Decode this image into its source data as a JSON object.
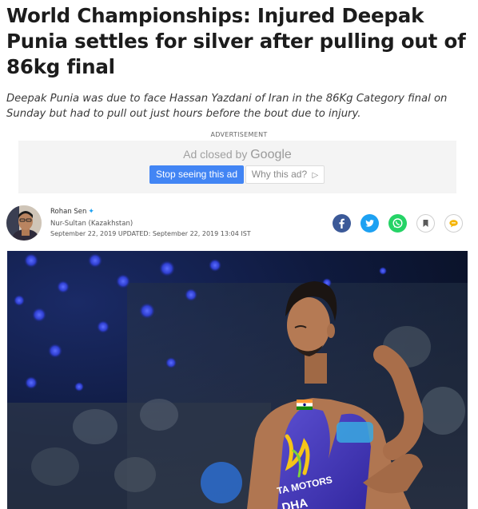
{
  "article": {
    "headline": "World Championships: Injured Deepak Punia settles for silver after pulling out of 86kg final",
    "summary": "Deepak Punia was due to face Hassan Yazdani of Iran in the 86Kg Category final on Sunday but had to pull out just hours before the bout due to injury."
  },
  "ad": {
    "label": "ADVERTISEMENT",
    "closed_text": "Ad closed by",
    "closed_brand": "Google",
    "stop_button": "Stop seeing this ad",
    "why_button": "Why this ad?",
    "why_icon": "adchoices-icon",
    "brand_color": "#4285f4"
  },
  "byline": {
    "author": "Rohan Sen",
    "author_icon": "twitter-icon",
    "location": "Nur-Sultan (Kazakhstan)",
    "dateline": "September 22, 2019  UPDATED: September 22, 2019 13:04 IST"
  },
  "share": [
    {
      "name": "facebook-icon",
      "color": "#3b5998"
    },
    {
      "name": "twitter-icon",
      "color": "#1da1f2"
    },
    {
      "name": "whatsapp-icon",
      "color": "#25d366"
    },
    {
      "name": "bookmark-icon",
      "color": "#5a5a5a"
    },
    {
      "name": "comment-icon",
      "color": "#f5b400"
    }
  ],
  "photo": {
    "singlet_text_1": "TA MOTORS",
    "singlet_text_2": "DHA",
    "singlet_color": "#4a3fb8"
  }
}
